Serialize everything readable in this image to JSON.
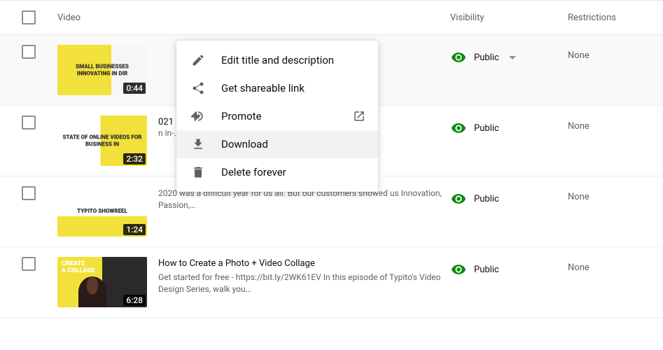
{
  "columns": {
    "video": "Video",
    "visibility": "Visibility",
    "restrictions": "Restrictions"
  },
  "rows": [
    {
      "thumb_style": "background: linear-gradient(90deg, #f2e13a 0 60%, #f6f6f6 60%);",
      "thumb_text": "SMALL BUSINESSES INNOVATING IN DIR",
      "duration": "0:44",
      "title": "",
      "title_fragment": "",
      "description": "",
      "visibility": "Public",
      "show_caret": true,
      "restrictions": "None",
      "hovered": true
    },
    {
      "thumb_style": "background: linear-gradient(90deg, #fff 0 48%, #f2e13a 48% 100%);",
      "thumb_text": "STATE OF ONLINE VIDEOS FOR BUSINESS IN",
      "duration": "2:32",
      "title": "",
      "title_fragment": "021",
      "description": "n in-…",
      "visibility": "Public",
      "show_caret": false,
      "restrictions": "None",
      "hovered": false
    },
    {
      "thumb_style": "background: linear-gradient(0deg, #f2e13a 0 40%, #fff 40%);",
      "thumb_text": "TYPITO SHOWREEL",
      "duration": "1:24",
      "title": "",
      "title_fragment": "",
      "description": "2020 was a difficult year for us all. But our customers showed us Innovation, Passion,…",
      "visibility": "Public",
      "show_caret": false,
      "restrictions": "None",
      "hovered": false
    },
    {
      "thumb_style": "background: linear-gradient(90deg, #f2e13a 0 50%, #2a2a2a 50%);",
      "thumb_text": "",
      "thumb_overlay": "CREATE A COLLAGE",
      "duration": "6:28",
      "title": "How to Create a Photo + Video Collage",
      "title_fragment": "",
      "description": "Get started for free - https://bit.ly/2WK61EV In this episode of Typito's Video Design Series, walk you…",
      "visibility": "Public",
      "show_caret": false,
      "restrictions": "None",
      "hovered": false
    }
  ],
  "menu": {
    "edit": "Edit title and description",
    "share": "Get shareable link",
    "promote": "Promote",
    "download": "Download",
    "delete": "Delete forever"
  }
}
